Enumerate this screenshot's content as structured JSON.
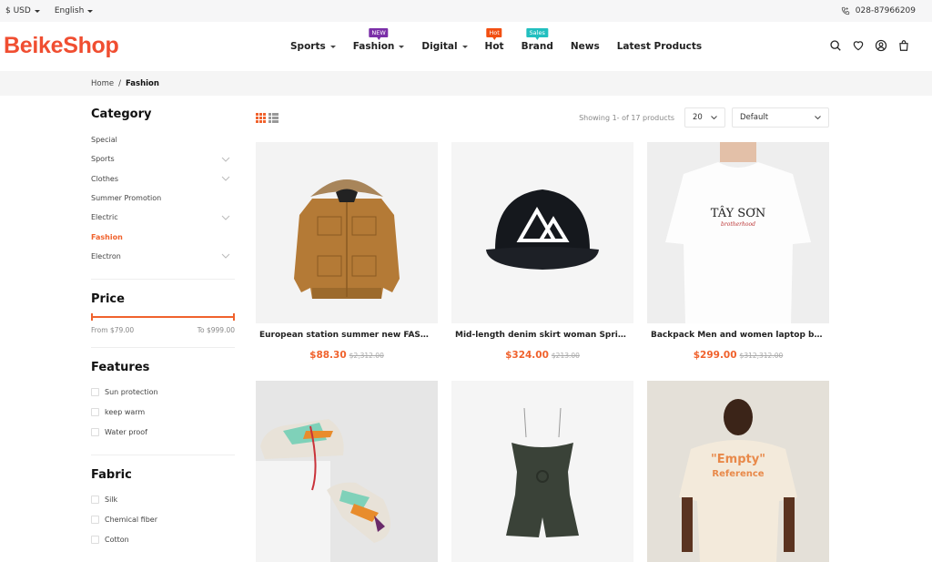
{
  "topbar": {
    "currency": "$ USD",
    "language": "English",
    "phone": "028-87966209"
  },
  "header": {
    "logo": "BeikeShop",
    "nav": [
      {
        "label": "Sports",
        "has_dropdown": true,
        "badge": null
      },
      {
        "label": "Fashion",
        "has_dropdown": true,
        "badge": {
          "text": "NEW",
          "color": "#7b2fa8"
        }
      },
      {
        "label": "Digital",
        "has_dropdown": true,
        "badge": null
      },
      {
        "label": "Hot",
        "has_dropdown": false,
        "badge": {
          "text": "Hot",
          "color": "#f24f12"
        }
      },
      {
        "label": "Brand",
        "has_dropdown": false,
        "badge": {
          "text": "Sales",
          "color": "#22bfbf"
        }
      },
      {
        "label": "News",
        "has_dropdown": false,
        "badge": null
      },
      {
        "label": "Latest Products",
        "has_dropdown": false,
        "badge": null
      }
    ],
    "icons": [
      "search-icon",
      "heart-icon",
      "account-icon",
      "cart-icon"
    ]
  },
  "breadcrumb": {
    "home": "Home",
    "separator": "/",
    "current": "Fashion"
  },
  "sidebar": {
    "category_title": "Category",
    "categories": [
      {
        "label": "Special",
        "expandable": false,
        "active": false
      },
      {
        "label": "Sports",
        "expandable": true,
        "active": false
      },
      {
        "label": "Clothes",
        "expandable": true,
        "active": false
      },
      {
        "label": "Summer Promotion",
        "expandable": false,
        "active": false
      },
      {
        "label": "Electric",
        "expandable": true,
        "active": false
      },
      {
        "label": "Fashion",
        "expandable": false,
        "active": true
      },
      {
        "label": "Electron",
        "expandable": true,
        "active": false
      }
    ],
    "price_title": "Price",
    "price_from": "From $79.00",
    "price_to": "To $999.00",
    "features_title": "Features",
    "features": [
      "Sun protection",
      "keep warm",
      "Water proof"
    ],
    "fabric_title": "Fabric",
    "fabrics": [
      "Silk",
      "Chemical fiber",
      "Cotton"
    ]
  },
  "toolbar": {
    "showing": "Showing 1- of 17 products",
    "per_page": "20",
    "sort": "Default"
  },
  "products": [
    {
      "name": "European station summer new FASHION...",
      "price": "$88.30",
      "old_price": "$2,312.00",
      "image": "brown-hooded-jacket"
    },
    {
      "name": "Mid-length denim skirt woman Spring/...",
      "price": "$324.00",
      "old_price": "$213.00",
      "image": "black-cap-mountain-logo"
    },
    {
      "name": "Backpack Men and women laptop bag ...",
      "price": "$299.00",
      "old_price": "$312,312.00",
      "image": "white-tshirt-tay-son"
    },
    {
      "name": "",
      "price": "",
      "old_price": "",
      "image": "colorful-sneakers"
    },
    {
      "name": "",
      "price": "",
      "old_price": "",
      "image": "dark-green-romper"
    },
    {
      "name": "",
      "price": "",
      "old_price": "",
      "image": "empty-reference-tshirt"
    }
  ],
  "colors": {
    "accent": "#f0622d",
    "logo": "#f04e31"
  }
}
